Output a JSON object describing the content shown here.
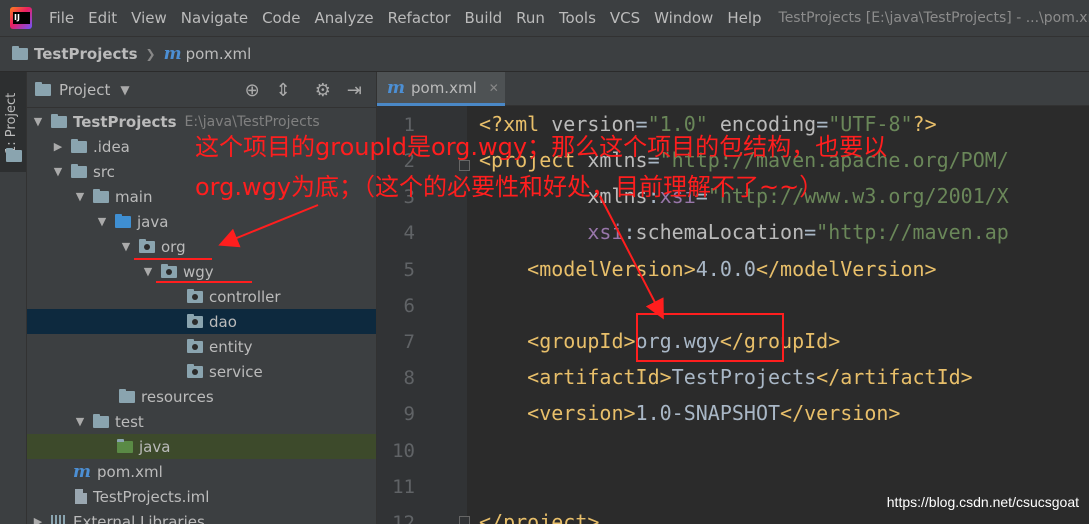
{
  "menu": [
    "File",
    "Edit",
    "View",
    "Navigate",
    "Code",
    "Analyze",
    "Refactor",
    "Build",
    "Run",
    "Tools",
    "VCS",
    "Window",
    "Help"
  ],
  "window_title": "TestProjects [E:\\java\\TestProjects] - ...\\pom.xml",
  "breadcrumb": {
    "project": "TestProjects",
    "file": "pom.xml"
  },
  "side_tab": "1: Project",
  "panel": {
    "title": "Project"
  },
  "tree": [
    {
      "label": "TestProjects",
      "hint": "E:\\java\\TestProjects"
    },
    {
      "label": ".idea"
    },
    {
      "label": "src"
    },
    {
      "label": "main"
    },
    {
      "label": "java"
    },
    {
      "label": "org"
    },
    {
      "label": "wgy"
    },
    {
      "label": "controller"
    },
    {
      "label": "dao"
    },
    {
      "label": "entity"
    },
    {
      "label": "service"
    },
    {
      "label": "resources"
    },
    {
      "label": "test"
    },
    {
      "label": "java"
    },
    {
      "label": "pom.xml"
    },
    {
      "label": "TestProjects.iml"
    },
    {
      "label": "External Libraries"
    }
  ],
  "editor": {
    "tab_label": "pom.xml",
    "line_numbers": [
      "1",
      "2",
      "3",
      "4",
      "5",
      "6",
      "7",
      "8",
      "9",
      "10",
      "11",
      "12"
    ]
  },
  "code": {
    "xml_decl_open": "<?xml ",
    "version_attr": "version",
    "version_val": "\"1.0\"",
    "encoding_attr": "encoding",
    "encoding_val": "\"UTF-8\"",
    "xml_decl_close": "?>",
    "project_open": "<project ",
    "xmlns_attr": "xmlns",
    "xmlns_val": "\"http://maven.apache.org/POM/",
    "xsi_prefix": "xmlns",
    "xsi_name": "xsi",
    "xsi_val": "\"http://www.w3.org/2001/X",
    "schema_ns": "xsi",
    "schema_attr": "schemaLocation",
    "schema_val": "\"http://maven.ap",
    "model_open": "<modelVersion>",
    "model_val": "4.0.0",
    "model_close": "</modelVersion>",
    "group_open": "<groupId>",
    "group_val": "org.wgy",
    "group_close": "</groupId>",
    "artifact_open": "<artifactId>",
    "artifact_val": "TestProjects",
    "artifact_close": "</artifactId>",
    "ver_open": "<version>",
    "ver_val": "1.0-SNAPSHOT",
    "ver_close": "</version>",
    "project_close": "</project>"
  },
  "annotation": {
    "line1": "这个项目的groupId是org.wgy；那么这个项目的包结构，也要以",
    "line2": "org.wgy为底；（这个的必要性和好处，目前理解不了~~）",
    "color": "#ff1e1e"
  },
  "watermark": "https://blog.csdn.net/csucsgoat"
}
